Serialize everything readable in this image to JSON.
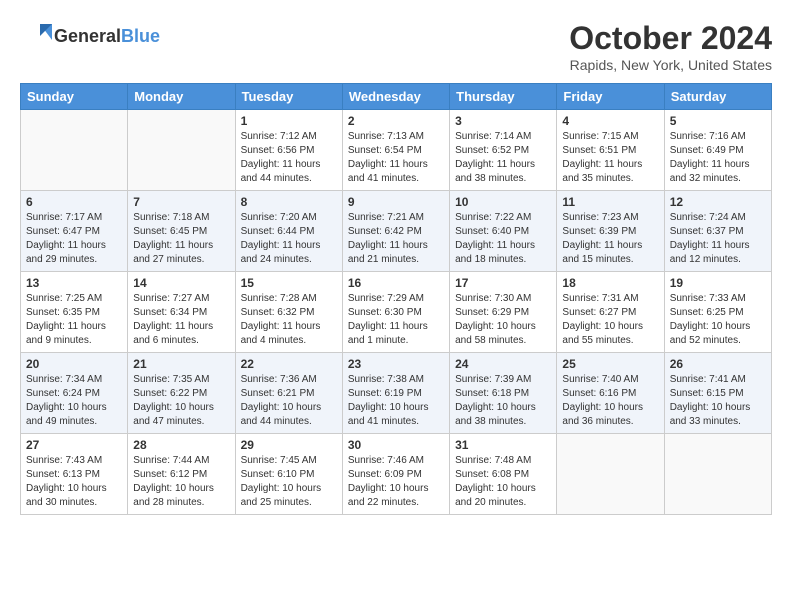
{
  "header": {
    "logo_general": "General",
    "logo_blue": "Blue",
    "month": "October 2024",
    "location": "Rapids, New York, United States"
  },
  "days_of_week": [
    "Sunday",
    "Monday",
    "Tuesday",
    "Wednesday",
    "Thursday",
    "Friday",
    "Saturday"
  ],
  "weeks": [
    [
      {
        "day": "",
        "info": ""
      },
      {
        "day": "",
        "info": ""
      },
      {
        "day": "1",
        "info": "Sunrise: 7:12 AM\nSunset: 6:56 PM\nDaylight: 11 hours and 44 minutes."
      },
      {
        "day": "2",
        "info": "Sunrise: 7:13 AM\nSunset: 6:54 PM\nDaylight: 11 hours and 41 minutes."
      },
      {
        "day": "3",
        "info": "Sunrise: 7:14 AM\nSunset: 6:52 PM\nDaylight: 11 hours and 38 minutes."
      },
      {
        "day": "4",
        "info": "Sunrise: 7:15 AM\nSunset: 6:51 PM\nDaylight: 11 hours and 35 minutes."
      },
      {
        "day": "5",
        "info": "Sunrise: 7:16 AM\nSunset: 6:49 PM\nDaylight: 11 hours and 32 minutes."
      }
    ],
    [
      {
        "day": "6",
        "info": "Sunrise: 7:17 AM\nSunset: 6:47 PM\nDaylight: 11 hours and 29 minutes."
      },
      {
        "day": "7",
        "info": "Sunrise: 7:18 AM\nSunset: 6:45 PM\nDaylight: 11 hours and 27 minutes."
      },
      {
        "day": "8",
        "info": "Sunrise: 7:20 AM\nSunset: 6:44 PM\nDaylight: 11 hours and 24 minutes."
      },
      {
        "day": "9",
        "info": "Sunrise: 7:21 AM\nSunset: 6:42 PM\nDaylight: 11 hours and 21 minutes."
      },
      {
        "day": "10",
        "info": "Sunrise: 7:22 AM\nSunset: 6:40 PM\nDaylight: 11 hours and 18 minutes."
      },
      {
        "day": "11",
        "info": "Sunrise: 7:23 AM\nSunset: 6:39 PM\nDaylight: 11 hours and 15 minutes."
      },
      {
        "day": "12",
        "info": "Sunrise: 7:24 AM\nSunset: 6:37 PM\nDaylight: 11 hours and 12 minutes."
      }
    ],
    [
      {
        "day": "13",
        "info": "Sunrise: 7:25 AM\nSunset: 6:35 PM\nDaylight: 11 hours and 9 minutes."
      },
      {
        "day": "14",
        "info": "Sunrise: 7:27 AM\nSunset: 6:34 PM\nDaylight: 11 hours and 6 minutes."
      },
      {
        "day": "15",
        "info": "Sunrise: 7:28 AM\nSunset: 6:32 PM\nDaylight: 11 hours and 4 minutes."
      },
      {
        "day": "16",
        "info": "Sunrise: 7:29 AM\nSunset: 6:30 PM\nDaylight: 11 hours and 1 minute."
      },
      {
        "day": "17",
        "info": "Sunrise: 7:30 AM\nSunset: 6:29 PM\nDaylight: 10 hours and 58 minutes."
      },
      {
        "day": "18",
        "info": "Sunrise: 7:31 AM\nSunset: 6:27 PM\nDaylight: 10 hours and 55 minutes."
      },
      {
        "day": "19",
        "info": "Sunrise: 7:33 AM\nSunset: 6:25 PM\nDaylight: 10 hours and 52 minutes."
      }
    ],
    [
      {
        "day": "20",
        "info": "Sunrise: 7:34 AM\nSunset: 6:24 PM\nDaylight: 10 hours and 49 minutes."
      },
      {
        "day": "21",
        "info": "Sunrise: 7:35 AM\nSunset: 6:22 PM\nDaylight: 10 hours and 47 minutes."
      },
      {
        "day": "22",
        "info": "Sunrise: 7:36 AM\nSunset: 6:21 PM\nDaylight: 10 hours and 44 minutes."
      },
      {
        "day": "23",
        "info": "Sunrise: 7:38 AM\nSunset: 6:19 PM\nDaylight: 10 hours and 41 minutes."
      },
      {
        "day": "24",
        "info": "Sunrise: 7:39 AM\nSunset: 6:18 PM\nDaylight: 10 hours and 38 minutes."
      },
      {
        "day": "25",
        "info": "Sunrise: 7:40 AM\nSunset: 6:16 PM\nDaylight: 10 hours and 36 minutes."
      },
      {
        "day": "26",
        "info": "Sunrise: 7:41 AM\nSunset: 6:15 PM\nDaylight: 10 hours and 33 minutes."
      }
    ],
    [
      {
        "day": "27",
        "info": "Sunrise: 7:43 AM\nSunset: 6:13 PM\nDaylight: 10 hours and 30 minutes."
      },
      {
        "day": "28",
        "info": "Sunrise: 7:44 AM\nSunset: 6:12 PM\nDaylight: 10 hours and 28 minutes."
      },
      {
        "day": "29",
        "info": "Sunrise: 7:45 AM\nSunset: 6:10 PM\nDaylight: 10 hours and 25 minutes."
      },
      {
        "day": "30",
        "info": "Sunrise: 7:46 AM\nSunset: 6:09 PM\nDaylight: 10 hours and 22 minutes."
      },
      {
        "day": "31",
        "info": "Sunrise: 7:48 AM\nSunset: 6:08 PM\nDaylight: 10 hours and 20 minutes."
      },
      {
        "day": "",
        "info": ""
      },
      {
        "day": "",
        "info": ""
      }
    ]
  ]
}
